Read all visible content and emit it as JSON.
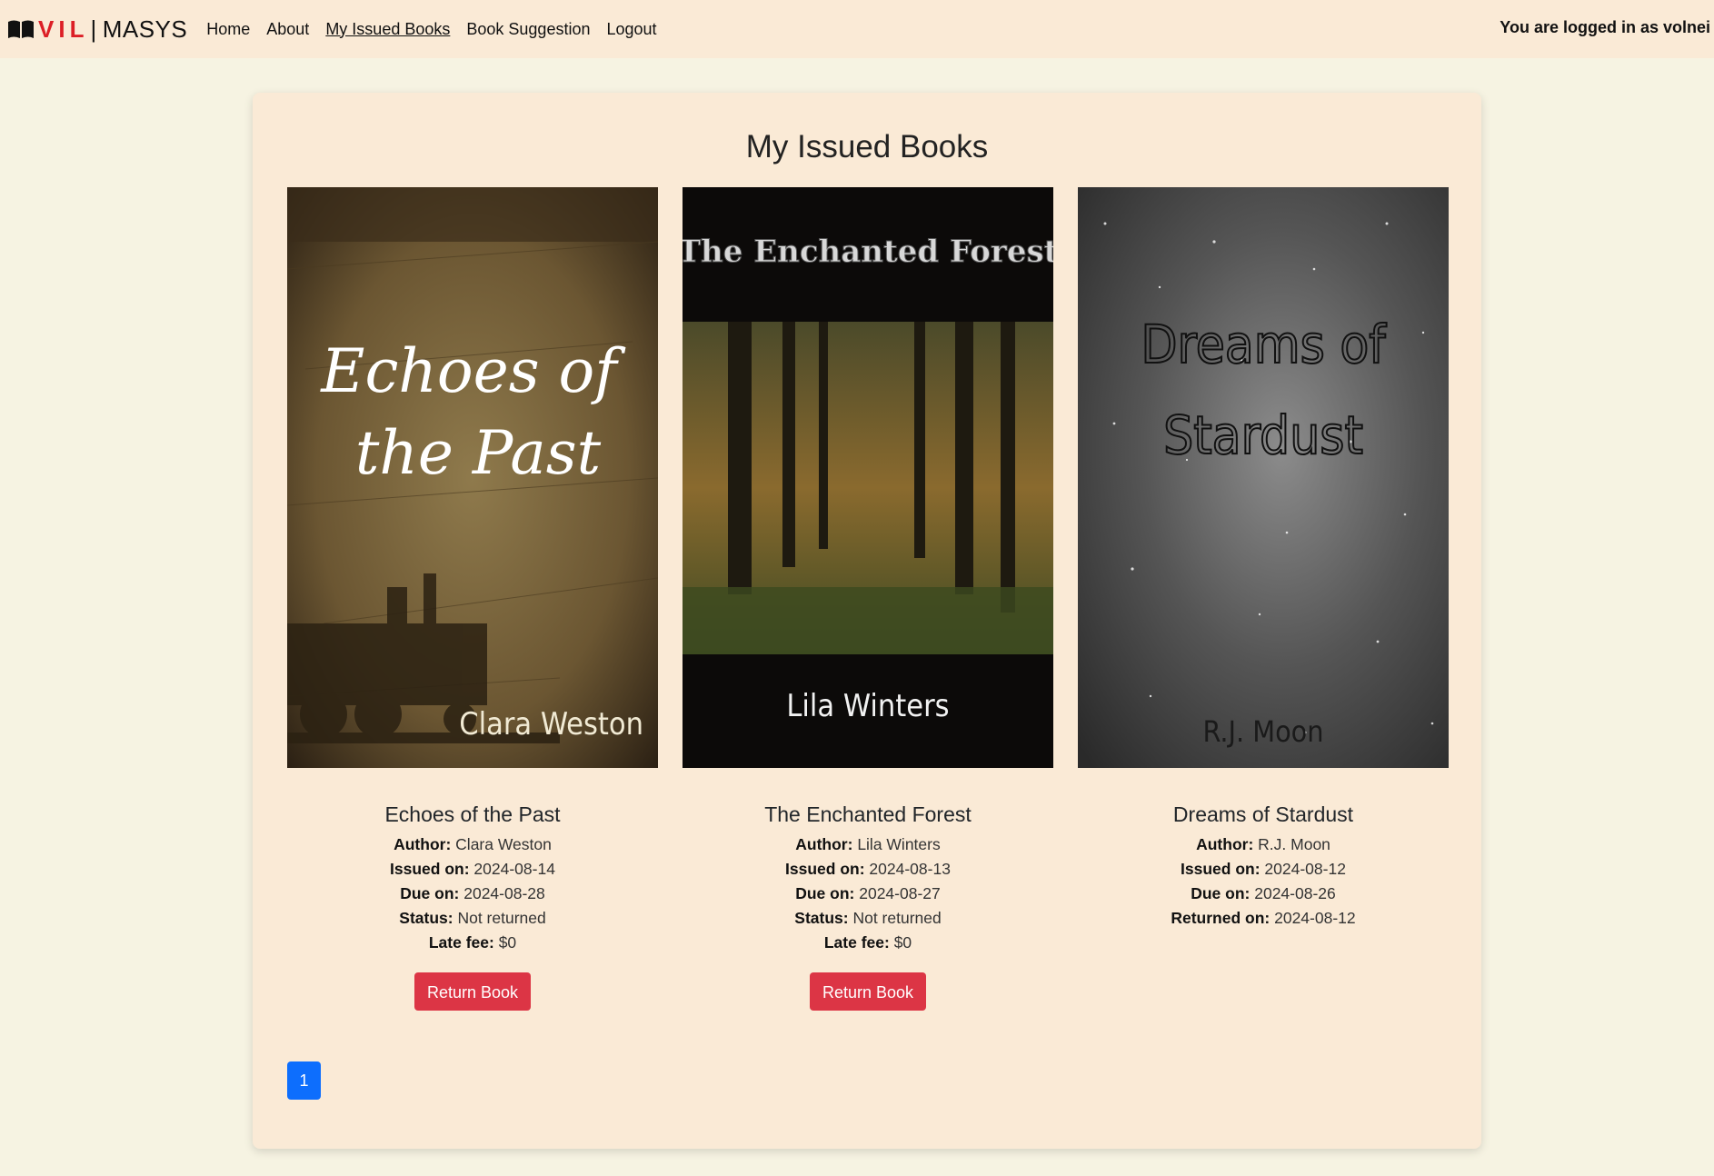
{
  "navbar": {
    "brand": {
      "part1": "VIL",
      "separator": "|",
      "part2": "MASYS",
      "icon": "open-book-icon"
    },
    "links": [
      {
        "label": "Home",
        "active": false
      },
      {
        "label": "About",
        "active": false
      },
      {
        "label": "My Issued Books",
        "active": true
      },
      {
        "label": "Book Suggestion",
        "active": false
      },
      {
        "label": "Logout",
        "active": false
      }
    ],
    "user_text": "You are logged in as volnei"
  },
  "main": {
    "title": "My Issued Books",
    "books": [
      {
        "title": "Echoes of the Past",
        "cover": {
          "title_line1": "Echoes of",
          "title_line2": "the Past",
          "author": "Clara Weston"
        },
        "author_label": "Author:",
        "author": "Clara Weston",
        "issued_label": "Issued on:",
        "issued": "2024-08-14",
        "due_label": "Due on:",
        "due": "2024-08-28",
        "status_label": "Status:",
        "status": "Not returned",
        "fee_label": "Late fee:",
        "fee": "$0",
        "button": "Return Book"
      },
      {
        "title": "The Enchanted Forest",
        "cover": {
          "title": "The Enchanted Forest",
          "author": "Lila Winters"
        },
        "author_label": "Author:",
        "author": "Lila Winters",
        "issued_label": "Issued on:",
        "issued": "2024-08-13",
        "due_label": "Due on:",
        "due": "2024-08-27",
        "status_label": "Status:",
        "status": "Not returned",
        "fee_label": "Late fee:",
        "fee": "$0",
        "button": "Return Book"
      },
      {
        "title": "Dreams of Stardust",
        "cover": {
          "title_line1": "Dreams of",
          "title_line2": "Stardust",
          "author": "R.J. Moon"
        },
        "author_label": "Author:",
        "author": "R.J. Moon",
        "issued_label": "Issued on:",
        "issued": "2024-08-12",
        "due_label": "Due on:",
        "due": "2024-08-26",
        "returned_label": "Returned on:",
        "returned": "2024-08-12"
      }
    ],
    "pagination": {
      "current": "1"
    }
  },
  "colors": {
    "page_bg": "#f6f3e2",
    "navbar_bg": "#faead6",
    "card_bg": "#faead6",
    "brand_red": "#dc1f26",
    "button_red": "#dc3545",
    "pager_blue": "#0d6efd"
  }
}
